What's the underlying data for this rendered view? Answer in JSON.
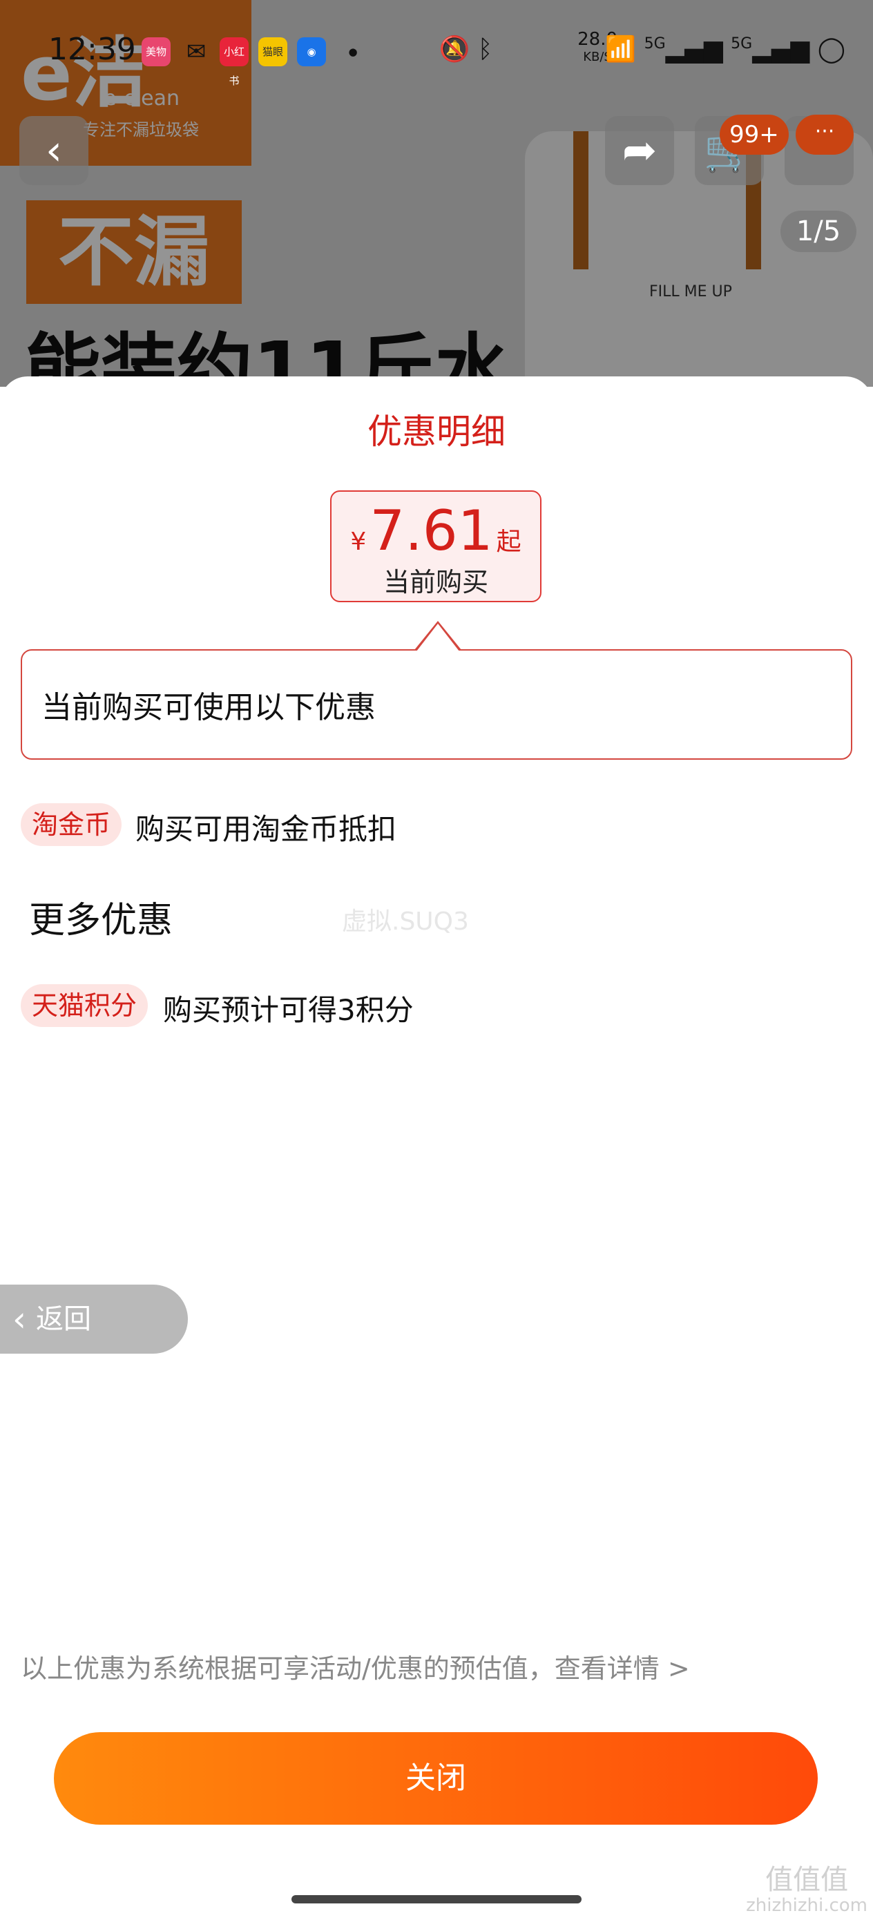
{
  "status_bar": {
    "time": "12:39",
    "apps": [
      "美物",
      "小红书",
      "猫眼"
    ],
    "speed_value": "28.0",
    "speed_unit": "KB/S",
    "net1": "5G",
    "net2": "5G"
  },
  "background_product": {
    "logo_text": "e洁",
    "logo_sub": "e-clean",
    "logo_tag": "专注不漏垃圾袋",
    "badge": "不漏",
    "headline": "能装约11斤水",
    "bag_print": "FILL ME UP"
  },
  "top_nav": {
    "back_icon": "chevron-left-icon",
    "share_icon": "share-icon",
    "cart_icon": "cart-icon",
    "cart_badge": "99+",
    "more_label": "···",
    "pager": "1/5"
  },
  "sheet": {
    "title": "优惠明细",
    "price": {
      "currency": "¥",
      "amount": "7.61",
      "suffix": "起",
      "caption": "当前购买"
    },
    "callout_text": "当前购买可使用以下优惠",
    "promos": [
      {
        "tag": "淘金币",
        "text": "购买可用淘金币抵扣"
      }
    ],
    "more_section_title": "更多优惠",
    "more_promos": [
      {
        "tag": "天猫积分",
        "text": "购买预计可得3积分"
      }
    ],
    "watermark": "虚拟.SUQ3",
    "back_label": "返回",
    "disclaimer": "以上优惠为系统根据可享活动/优惠的预估值，查看详情 >",
    "close_label": "关闭"
  },
  "corner_watermark": {
    "line1": "值值值",
    "line2": "zhizhizhi.com"
  },
  "colors": {
    "accent_red": "#d4201a",
    "button_start": "#ff8a0d",
    "button_end": "#ff4a0a",
    "tag_bg": "#fde4e2"
  }
}
